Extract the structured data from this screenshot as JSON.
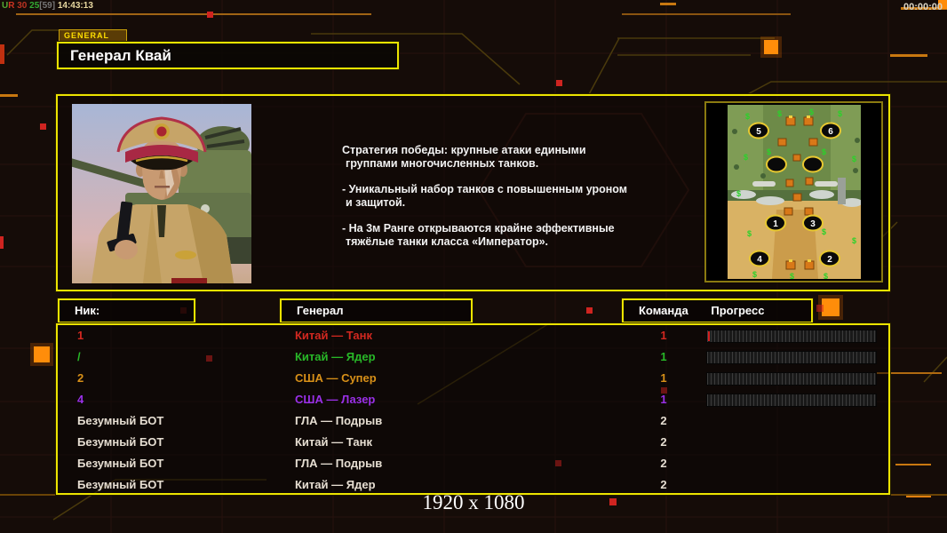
{
  "status_bar": {
    "debug_parts": [
      {
        "t": "U",
        "c": "#55aa33"
      },
      {
        "t": "R",
        "c": "#cc3322"
      },
      {
        "t": " 30",
        "c": "#bb3322"
      },
      {
        "t": " 25",
        "c": "#33aa33"
      },
      {
        "t": "[59]",
        "c": "#777777"
      },
      {
        "t": " 14:43:13",
        "c": "#e8d8a0"
      }
    ],
    "timer": "00:00:00"
  },
  "header": {
    "tab": "GENERAL",
    "title": "Генерал Квай"
  },
  "info": {
    "lines": [
      "Стратегия победы: крупные атаки едиными",
      "группами многочисленных танков.",
      "- Уникальный набор танков с повышенным уроном",
      "и защитой.",
      "- На 3м Ранге открываются крайне эффективные",
      "тяжёлые танки класса «Император»."
    ]
  },
  "map": {
    "money_symbol": "$",
    "positions": [
      {
        "label": "5"
      },
      {
        "label": "6"
      },
      {
        "label": "1"
      },
      {
        "label": "3"
      },
      {
        "label": "4"
      },
      {
        "label": "2"
      }
    ]
  },
  "table": {
    "headers": {
      "nick": "Ник:",
      "general": "Генерал",
      "team": "Команда",
      "progress": "Прогресс"
    },
    "rows": [
      {
        "nick": "1",
        "general": "Китай — Танк",
        "team": "1",
        "color": "#d22820",
        "progress_px": "2px"
      },
      {
        "nick": "/",
        "general": "Китай — Ядер",
        "team": "1",
        "color": "#28b828",
        "progress_px": "0px"
      },
      {
        "nick": "2",
        "general": "США — Супер",
        "team": "1",
        "color": "#d89018",
        "progress_px": "0px"
      },
      {
        "nick": "4",
        "general": "США — Лазер",
        "team": "1",
        "color": "#9a30e8",
        "progress_px": "0px"
      },
      {
        "nick": "Безумный БОТ",
        "general": "ГЛА — Подрыв",
        "team": "2",
        "color": "#e6ded2"
      },
      {
        "nick": "Безумный БОТ",
        "general": "Китай — Танк",
        "team": "2",
        "color": "#e6ded2"
      },
      {
        "nick": "Безумный БОТ",
        "general": "ГЛА — Подрыв",
        "team": "2",
        "color": "#e6ded2"
      },
      {
        "nick": "Безумный БОТ",
        "general": "Китай — Ядер",
        "team": "2",
        "color": "#e6ded2"
      }
    ]
  },
  "footer": {
    "resolution": "1920 x 1080"
  },
  "colors": {
    "panel_border": "#ece400",
    "accent_orange": "#e08010",
    "decor_red": "#cf2420"
  }
}
